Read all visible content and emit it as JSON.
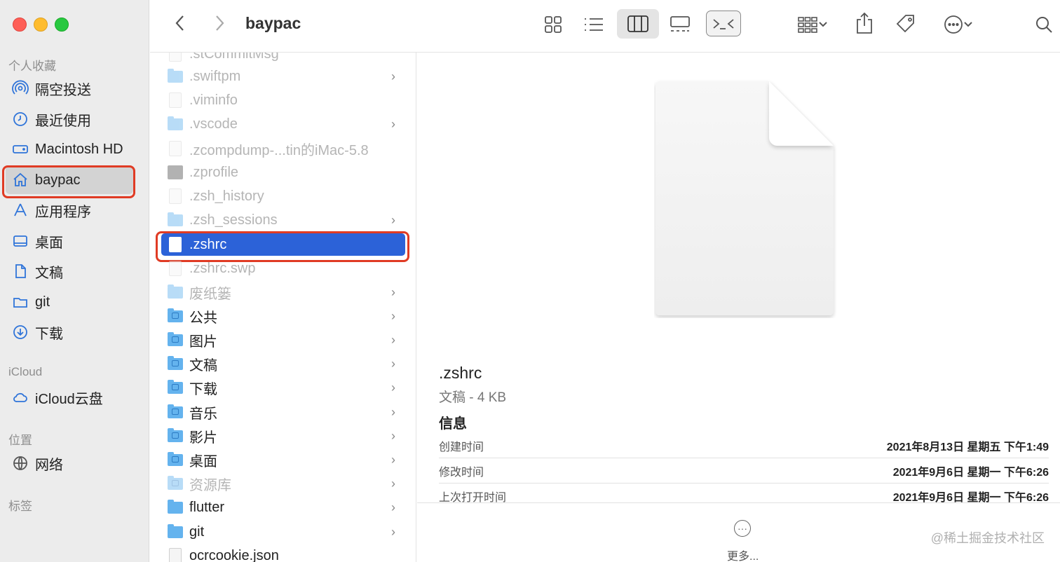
{
  "window": {
    "title": "baypac"
  },
  "sidebar": {
    "sections": [
      {
        "title": "个人收藏"
      },
      {
        "title": "iCloud"
      },
      {
        "title": "位置"
      },
      {
        "title": "标签"
      }
    ],
    "favorites": [
      {
        "label": "隔空投送",
        "icon": "airdrop-icon"
      },
      {
        "label": "最近使用",
        "icon": "clock-icon"
      },
      {
        "label": "Macintosh HD",
        "icon": "harddrive-icon"
      },
      {
        "label": "baypac",
        "icon": "home-icon",
        "selected": true
      },
      {
        "label": "应用程序",
        "icon": "applications-icon"
      },
      {
        "label": "桌面",
        "icon": "desktop-icon"
      },
      {
        "label": "文稿",
        "icon": "document-icon"
      },
      {
        "label": "git",
        "icon": "folder-icon"
      },
      {
        "label": "下载",
        "icon": "download-icon"
      }
    ],
    "icloud": [
      {
        "label": "iCloud云盘",
        "icon": "cloud-icon"
      }
    ],
    "locations": [
      {
        "label": "网络",
        "icon": "network-icon"
      }
    ]
  },
  "column": {
    "items": [
      {
        "label": ".stCommitMsg",
        "type": "doc",
        "dim": true
      },
      {
        "label": ".swiftpm",
        "type": "folder",
        "dim": true,
        "chevron": true
      },
      {
        "label": ".viminfo",
        "type": "doc",
        "dim": true
      },
      {
        "label": ".vscode",
        "type": "folder",
        "dim": true,
        "chevron": true
      },
      {
        "label": ".zcompdump-...tin的iMac-5.8",
        "type": "doc",
        "dim": true
      },
      {
        "label": ".zprofile",
        "type": "terminal",
        "dim": true
      },
      {
        "label": ".zsh_history",
        "type": "doc",
        "dim": true
      },
      {
        "label": ".zsh_sessions",
        "type": "folder",
        "dim": true,
        "chevron": true
      },
      {
        "label": ".zshrc",
        "type": "doc",
        "selected": true
      },
      {
        "label": ".zshrc.swp",
        "type": "doc",
        "dim": true
      },
      {
        "label": "废纸篓",
        "type": "folder",
        "dim": true,
        "chevron": true
      },
      {
        "label": "公共",
        "type": "folder",
        "chevron": true
      },
      {
        "label": "图片",
        "type": "folder",
        "chevron": true
      },
      {
        "label": "文稿",
        "type": "folder",
        "chevron": true
      },
      {
        "label": "下载",
        "type": "folder",
        "chevron": true
      },
      {
        "label": "音乐",
        "type": "folder",
        "chevron": true
      },
      {
        "label": "影片",
        "type": "folder",
        "chevron": true
      },
      {
        "label": "桌面",
        "type": "folder",
        "chevron": true
      },
      {
        "label": "资源库",
        "type": "folder",
        "dim": true,
        "chevron": true
      },
      {
        "label": "flutter",
        "type": "folder",
        "chevron": true
      },
      {
        "label": "git",
        "type": "folder",
        "chevron": true
      },
      {
        "label": "ocrcookie.json",
        "type": "doc"
      }
    ]
  },
  "preview": {
    "name": ".zshrc",
    "kind": "文稿 - 4 KB",
    "info_title": "信息",
    "info": [
      {
        "key": "创建时间",
        "value": "2021年8月13日 星期五 下午1:49"
      },
      {
        "key": "修改时间",
        "value": "2021年9月6日 星期一 下午6:26"
      },
      {
        "key": "上次打开时间",
        "value": "2021年9月6日 星期一 下午6:26"
      }
    ],
    "more_label": "更多..."
  },
  "watermark": "@稀土掘金技术社区"
}
